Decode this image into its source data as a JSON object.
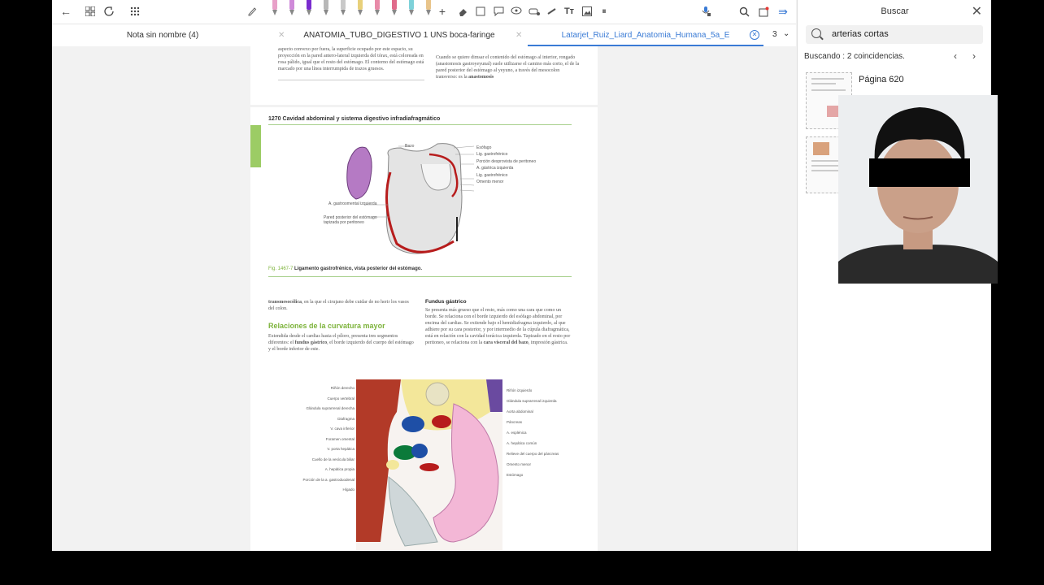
{
  "tabs": [
    {
      "label": "Nota sin nombre (4)",
      "active": false
    },
    {
      "label": "ANATOMIA_TUBO_DIGESTIVO 1 UNS boca-faringe",
      "active": false
    },
    {
      "label": "Latarjet_Ruiz_Liard_Anatomia_Humana_5a_E",
      "active": true
    }
  ],
  "tab_count": "3",
  "toolbar": {
    "pen_colors": [
      "#e8a0c8",
      "#cf8ad9",
      "#7a2ccf",
      "#b8b8b8",
      "#c9c9c9",
      "#e8d07a",
      "#e88aa8",
      "#e06b8b",
      "#7ed1d9",
      "#e8c48a"
    ],
    "accent": "#3a7bd5"
  },
  "document": {
    "top_left_text": "aspecto convexo por fuera, la superficie ocupado por este espacio, su proyección en la pared antero-lateral izquierda del tórax, está coloreada en rosa pálido, igual que el resto del estómago. El contorno del estómago está marcado por una línea interrumpida de trazos gruesos.",
    "top_right_text": "Cuando se quiere dimsar el contenido del estómago al interior, rongado (anastomosis gastroyeyunal) suele utilizarse el camino más corto, el de la pared posterior del estómago al yeyuno, a través del mesocolon transverso: es la",
    "top_right_bold": "anastomosis",
    "page_header": "1270 Cavidad abdominal y sistema digestivo infradiafragmático",
    "fig1_labels_right": [
      "Esófago",
      "Lig. gastrofrénico",
      "Porción desprovista de peritoneo",
      "A. gástrica izquierda",
      "Lig. gastrofrénico",
      "Omento menor"
    ],
    "fig1_label_spleen": "Bazo",
    "fig1_labels_left": [
      "A. gastroomental izquierda",
      "Pared posterior del estómago tapizada por peritoneo"
    ],
    "fig1_caption_num": "Fig. 1467-7",
    "fig1_caption": "Ligamento gastrofrénico, vista posterior del estómago.",
    "col1_bold": "transmesocólica",
    "col1_text": ", en la que el cirujano debe cuidar de no herir los vasos del colon.",
    "section_heading": "Relaciones de la curvatura mayor",
    "section_text": "Extendida desde el cardias hasta el píloro, presenta tres segmentos diferentes: el",
    "section_bold": "fundus gástrico",
    "section_text2": ", el borde izquierdo del cuerpo del estómago y el borde inferior de este.",
    "col2_heading": "Fundus gástrico",
    "col2_text": "Se presenta más grueso que el resto, más como una cara que como un borde. Se relaciona con el borde izquierdo del esófago abdominal, por encima del cardias. Se extiende bajo el hemidiafragma izquierdo, al que adhiere por su cara posterior, y por intermedio de la cúpula diafragmática, está en relación con la cavidad torácica izquierda. Tapizado en el resto por peritoneo, se relaciona con la",
    "col2_bold": "cara visceral del bazo",
    "col2_text2": ", impresión gástrica.",
    "fig2_labels_left": [
      "Riñón derecho",
      "Cuerpo vertebral",
      "Glándula suprarrenal derecha",
      "Diafragma",
      "V. cava inferior",
      "Foramen omental",
      "V. porta hepática",
      "Cuello de la vesícula biliar",
      "A. hepática propia",
      "Porción de la a. gastroduodenal",
      "Hígado"
    ],
    "fig2_labels_right": [
      "Riñón izquierdo",
      "Glándula suprarrenal izquierda",
      "Aorta abdominal",
      "Páncreas",
      "A. esplénica",
      "A. hepática común",
      "Relieve del cuerpo del páncreas",
      "Omento menor",
      "Estómago"
    ]
  },
  "search_panel": {
    "title": "Buscar",
    "query": "arterias cortas",
    "status": "Buscando : 2 coincidencias.",
    "results": [
      {
        "label": "Página 620"
      }
    ]
  }
}
